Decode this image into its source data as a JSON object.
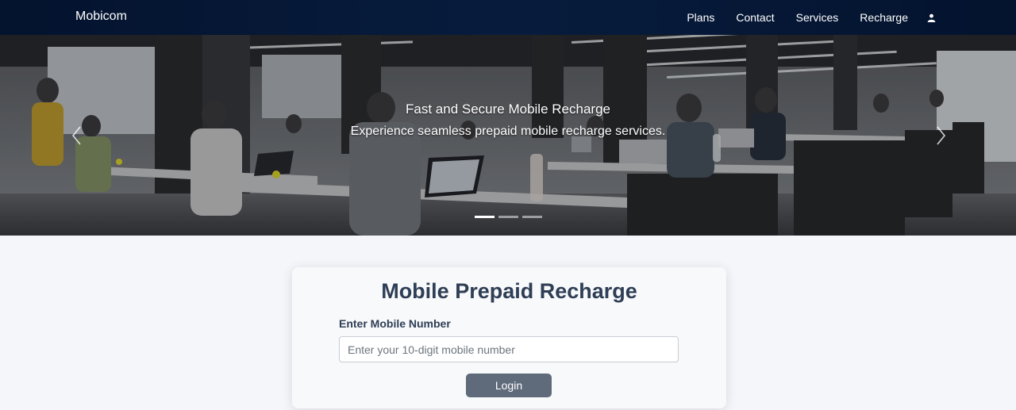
{
  "navbar": {
    "brand": "Mobicom",
    "links": [
      "Plans",
      "Contact",
      "Services",
      "Recharge"
    ],
    "user_icon": "person-icon"
  },
  "hero": {
    "title": "Fast and Secure Mobile Recharge",
    "subtitle": "Experience seamless prepaid mobile recharge services.",
    "slide_count": 3,
    "active_slide": 1,
    "prev_icon": "chevron-left-icon",
    "next_icon": "chevron-right-icon"
  },
  "recharge_card": {
    "title": "Mobile Prepaid Recharge",
    "label": "Enter Mobile Number",
    "input_value": "",
    "input_placeholder": "Enter your 10-digit mobile number",
    "button_label": "Login"
  },
  "colors": {
    "navbar": "#071c3d",
    "page_background": "#f4f6fa",
    "button": "#5f6b7a",
    "heading_text": "#2e3e55"
  }
}
